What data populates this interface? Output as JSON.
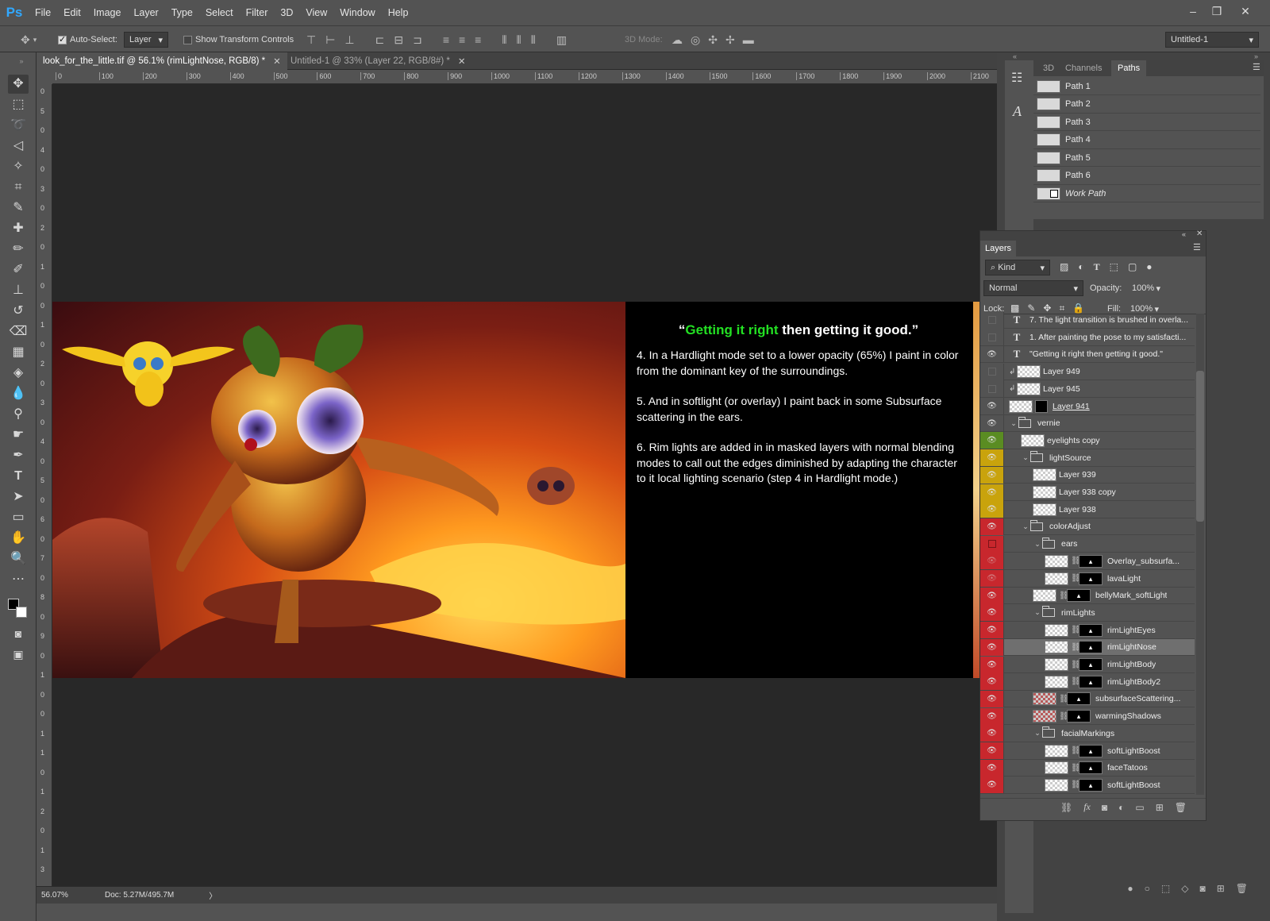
{
  "app": {
    "logo": "Ps"
  },
  "menu": [
    "File",
    "Edit",
    "Image",
    "Layer",
    "Type",
    "Select",
    "Filter",
    "3D",
    "View",
    "Window",
    "Help"
  ],
  "window_controls": {
    "minimize": "–",
    "restore": "❐",
    "close": "✕"
  },
  "options": {
    "auto_select_label": "Auto-Select:",
    "auto_select_target": "Layer",
    "show_transform_label": "Show Transform Controls",
    "mode_3d_label": "3D Mode:",
    "workspace": "Untitled-1"
  },
  "doc_tabs": [
    {
      "label": "look_for_the_little.tif @ 56.1% (rimLightNose, RGB/8) *",
      "close": "✕"
    },
    {
      "label": "Untitled-1 @ 33% (Layer 22, RGB/8#) *",
      "close": "✕"
    }
  ],
  "ruler_h": [
    "0",
    "100",
    "200",
    "300",
    "400",
    "500",
    "600",
    "700",
    "800",
    "900",
    "1000",
    "1100",
    "1200",
    "1300",
    "1400",
    "1500",
    "1600",
    "1700",
    "1800",
    "1900",
    "2000",
    "2100"
  ],
  "ruler_v": [
    "0",
    "5",
    "0",
    "4",
    "0",
    "3",
    "0",
    "2",
    "0",
    "1",
    "0",
    "0",
    "1",
    "0",
    "2",
    "0",
    "3",
    "0",
    "4",
    "0",
    "5",
    "0",
    "6",
    "0",
    "7",
    "0",
    "8",
    "0",
    "9",
    "0",
    "1",
    "0",
    "0",
    "1",
    "1",
    "0",
    "1",
    "2",
    "0",
    "1",
    "3"
  ],
  "artwork": {
    "quote_open": "“",
    "quote_green": "Getting it right",
    "quote_rest": " then getting it good.”",
    "paragraphs": [
      "4.  In a Hardlight mode set to a lower opacity (65%)  I paint in color from the dominant key of the surroundings.",
      "5.  And in softlight (or overlay) I paint back in some Subsurface scattering in the ears.",
      "6.  Rim lights are added in in masked layers with normal blending modes to call out the edges diminished by adapting the character to it local lighting scenario (step 4 in Hardlight mode.)"
    ]
  },
  "status": {
    "zoom": "56.07%",
    "doc": "Doc: 5.27M/495.7M",
    "arrow": "〉"
  },
  "paths_panel": {
    "tabs": [
      "3D",
      "Channels",
      "Paths"
    ],
    "paths": [
      "Path 1",
      "Path 2",
      "Path 3",
      "Path 4",
      "Path 5",
      "Path 6",
      "Work Path"
    ]
  },
  "layers_panel": {
    "title": "Layers",
    "filter_kind": "Kind",
    "blend_mode": "Normal",
    "opacity_label": "Opacity:",
    "opacity": "100%",
    "lock_label": "Lock:",
    "fill_label": "Fill:",
    "fill": "100%",
    "layers": [
      {
        "name": "7. The light transition is brushed in overla...",
        "type": "text",
        "eye": "off"
      },
      {
        "name": "1. After painting the pose to my satisfacti...",
        "type": "text",
        "eye": "off"
      },
      {
        "name": "\"Getting it right then getting it good.\"",
        "type": "text",
        "eye": "on"
      },
      {
        "name": "Layer 949",
        "type": "clip",
        "eye": "off"
      },
      {
        "name": "Layer 945",
        "type": "clip",
        "eye": "off"
      },
      {
        "name": "Layer 941",
        "type": "layer",
        "eye": "on"
      },
      {
        "name": "vernie",
        "type": "group",
        "eye": "on"
      },
      {
        "name": "eyelights copy",
        "type": "layer",
        "eye": "green"
      },
      {
        "name": "lightSource",
        "type": "group",
        "eye": "yellow"
      },
      {
        "name": "Layer 939",
        "type": "layer",
        "eye": "yellow"
      },
      {
        "name": "Layer 938 copy",
        "type": "layer",
        "eye": "yellow"
      },
      {
        "name": "Layer 938",
        "type": "layer",
        "eye": "yellow"
      },
      {
        "name": "colorAdjust",
        "type": "group",
        "eye": "red"
      },
      {
        "name": "ears",
        "type": "group",
        "eye": "redoff"
      },
      {
        "name": "Overlay_subsurfa...",
        "type": "masked",
        "eye": "redfaint"
      },
      {
        "name": "lavaLight",
        "type": "masked",
        "eye": "redfaint"
      },
      {
        "name": "bellyMark_softLight",
        "type": "masked",
        "eye": "red"
      },
      {
        "name": "rimLights",
        "type": "group",
        "eye": "red"
      },
      {
        "name": "rimLightEyes",
        "type": "masked",
        "eye": "red"
      },
      {
        "name": "rimLightNose",
        "type": "masked",
        "eye": "red",
        "selected": true
      },
      {
        "name": "rimLightBody",
        "type": "masked",
        "eye": "red"
      },
      {
        "name": "rimLightBody2",
        "type": "masked",
        "eye": "red"
      },
      {
        "name": "subsurfaceScattering...",
        "type": "masked",
        "eye": "red"
      },
      {
        "name": "warmingShadows",
        "type": "masked",
        "eye": "red"
      },
      {
        "name": "facialMarkings",
        "type": "group",
        "eye": "red"
      },
      {
        "name": "softLightBoost",
        "type": "masked",
        "eye": "red"
      },
      {
        "name": "faceTatoos",
        "type": "masked",
        "eye": "red"
      },
      {
        "name": "softLightBoost",
        "type": "masked",
        "eye": "red"
      }
    ]
  },
  "colors": {
    "eye_red": "#c8272d",
    "eye_yellow": "#c9a30c",
    "eye_green": "#5a8c22",
    "quote_green": "#23e023",
    "ps_blue": "#31a8ff"
  }
}
